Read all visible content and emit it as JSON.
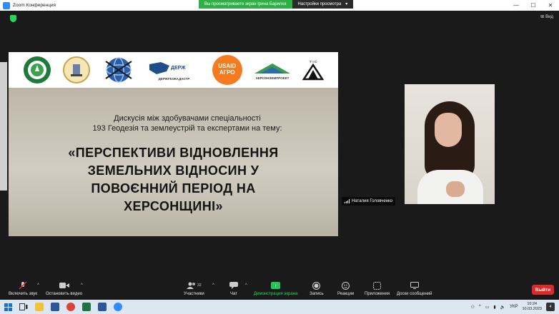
{
  "window": {
    "title": "Zoom Конференция",
    "share_status": "Вы просматриваете экран Ірина Барилка",
    "share_options": "Настройки просмотра",
    "view_label": "Вид"
  },
  "slide": {
    "logos": {
      "derzhgeo": "ДЕРЖГЕОКАДАСТР",
      "usaid_top": "USAID",
      "usaid_bottom": "АГРО",
      "khersonzem": "ХЕРСОНЗЕМПРОЕКТ",
      "gis": "Г І С"
    },
    "subtitle_line1": "Дискусія між здобувачами спеціальності",
    "subtitle_line2": "193 Геодезія та землеустрій та експертами на тему:",
    "headline_line1": "«ПЕРСПЕКТИВИ ВІДНОВЛЕННЯ",
    "headline_line2": "ЗЕМЕЛЬНИХ ВІДНОСИН У",
    "headline_line3": "ПОВОЄННИЙ ПЕРІОД НА",
    "headline_line4": "ХЕРСОНЩИНІ»"
  },
  "participant": {
    "name": "Наталия Головченко"
  },
  "toolbar": {
    "mute_label": "Включить звук",
    "video_label": "Остановить видео",
    "participants_label": "Участники",
    "participants_count": "32",
    "chat_label": "Чат",
    "share_label": "Демонстрация экрана",
    "record_label": "Запись",
    "reactions_label": "Реакции",
    "apps_label": "Приложения",
    "whiteboard_label": "Доски сообщений",
    "leave_label": "Выйти"
  },
  "taskbar": {
    "language": "УКР",
    "time": "10:24",
    "date": "10.03.2023",
    "notifications": "4"
  },
  "colors": {
    "zoom_blue": "#2d8cff",
    "share_green": "#2fb046",
    "leave_red": "#e02828",
    "usaid_orange": "#f47b20"
  }
}
